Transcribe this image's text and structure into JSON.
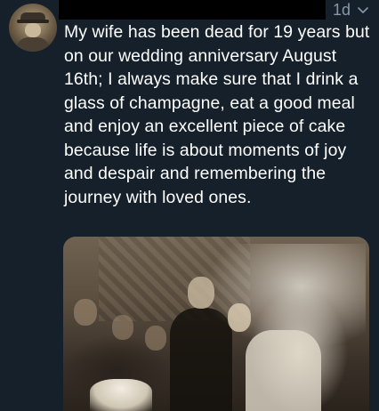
{
  "tweet": {
    "timestamp": "1d",
    "text": "My wife has been dead for 19 years but on our wedding anniversary August 16th; I always make sure that I drink a glass of champagne, eat a good meal and enjoy an excellent piece of cake because life is about moments of joy and despair and remembering the journey with loved ones."
  },
  "icons": {
    "chevron": "chevron-down-icon"
  },
  "colors": {
    "background": "#15202b",
    "text": "#ffffff",
    "muted": "#8899a6",
    "redaction": "#000000"
  }
}
